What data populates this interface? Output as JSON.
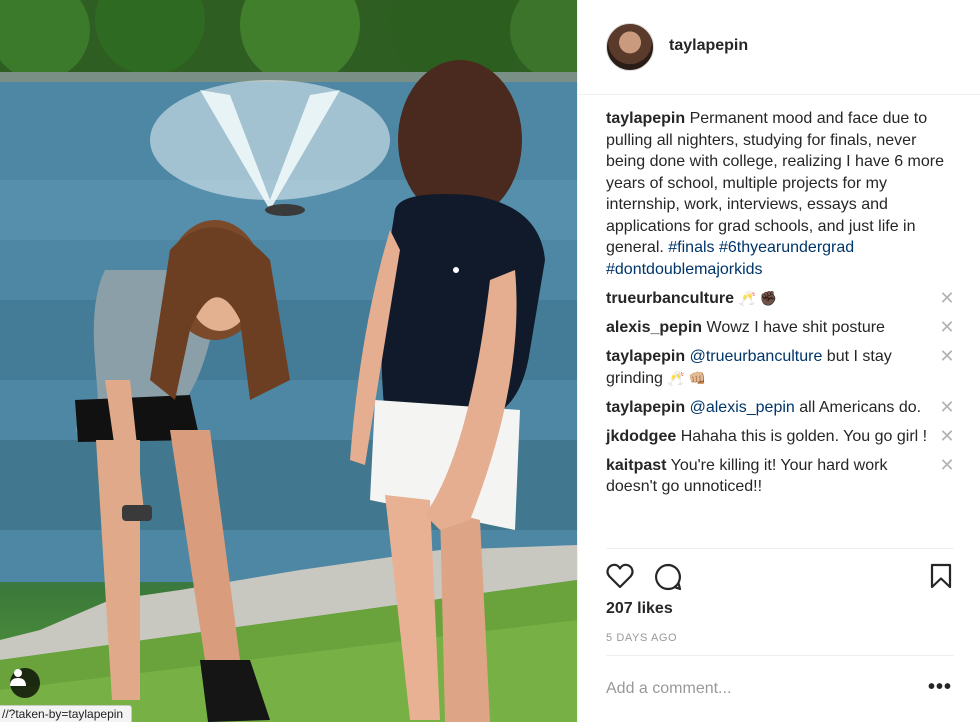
{
  "post": {
    "username": "taylapepin",
    "caption_text": "Permanent mood and face due to pulling all nighters, studying for finals, never being done with college, realizing I have 6 more years of school, multiple projects for my internship, work, interviews, essays and applications for grad schools, and just life in general. ",
    "hashtags": [
      "#finals",
      "#6thyearundergrad",
      "#dontdoublemajorkids"
    ],
    "likes": "207 likes",
    "time_ago": "5 DAYS AGO"
  },
  "comments": [
    {
      "user": "trueurbanculture",
      "text": "",
      "emoji": "🥂 ✊🏿"
    },
    {
      "user": "alexis_pepin",
      "text": "Wowz I have shit posture",
      "emoji": ""
    },
    {
      "user": "taylapepin",
      "mention": "@trueurbanculture",
      "text": " but I stay grinding ",
      "emoji": "🥂 👊🏼"
    },
    {
      "user": "taylapepin",
      "mention": "@alexis_pepin",
      "text": " all Americans do.",
      "emoji": ""
    },
    {
      "user": "jkdodgee",
      "text": "Hahaha this is golden. You go girl !",
      "emoji": ""
    },
    {
      "user": "kaitpast",
      "text": "You're killing it! Your hard work doesn't go unnoticed!!",
      "emoji": ""
    }
  ],
  "add_comment": {
    "placeholder": "Add a comment..."
  },
  "more_label": "•••",
  "delete_label": "✕",
  "status_bar_url": "//?taken-by=taylapepin",
  "icons": {
    "like": "heart-icon",
    "comment": "comment-bubble-icon",
    "save": "bookmark-icon",
    "user_tag": "person-icon"
  },
  "colors": {
    "text": "#262626",
    "link": "#003569",
    "muted": "#999999",
    "divider": "#efefef"
  }
}
